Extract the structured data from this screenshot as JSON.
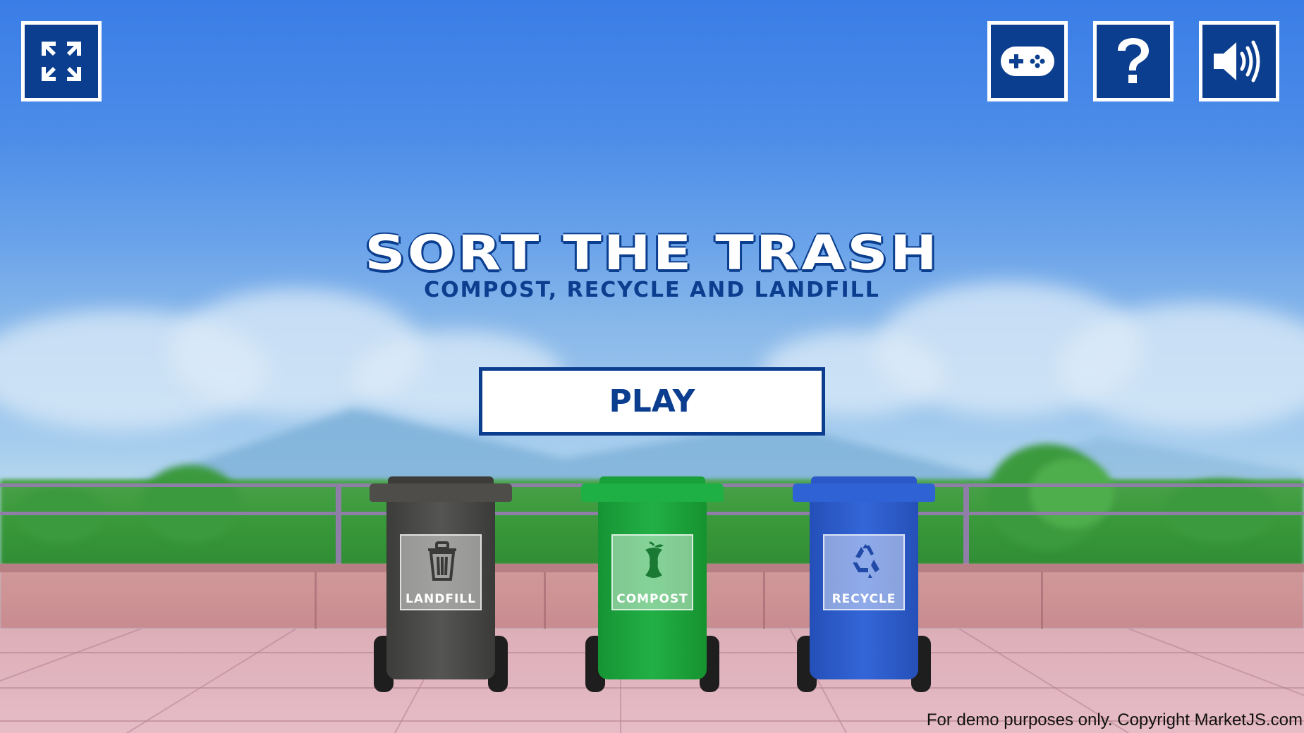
{
  "title": "SORT THE TRASH",
  "subtitle": "COMPOST, RECYCLE AND LANDFILL",
  "play_label": "PLAY",
  "hud": {
    "fullscreen_icon": "expand-arrows-icon",
    "controls_icon": "gamepad-icon",
    "help_icon": "question-mark-icon",
    "sound_icon": "speaker-volume-icon"
  },
  "bins": [
    {
      "label": "LANDFILL",
      "icon": "trash-can-icon",
      "color": "#4a4a48"
    },
    {
      "label": "COMPOST",
      "icon": "apple-core-icon",
      "color": "#1fa83e"
    },
    {
      "label": "RECYCLE",
      "icon": "recycle-icon",
      "color": "#2d5fd0"
    }
  ],
  "copyright": "For demo purposes only. Copyright MarketJS.com",
  "colors": {
    "accent": "#0b3e8e",
    "sky_top": "#3a7de6"
  }
}
